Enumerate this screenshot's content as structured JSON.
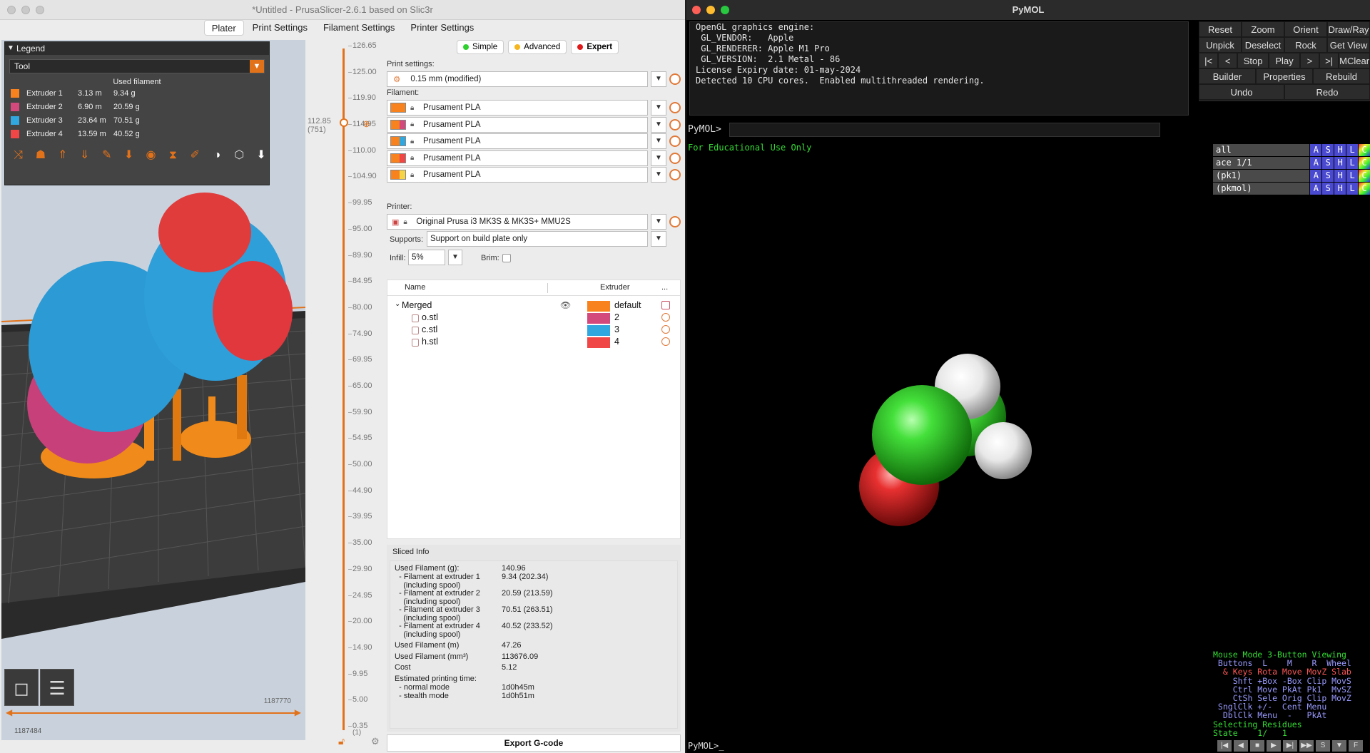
{
  "prusa": {
    "title": "*Untitled - PrusaSlicer-2.6.1 based on Slic3r",
    "tabs": [
      "Plater",
      "Print Settings",
      "Filament Settings",
      "Printer Settings"
    ],
    "legend": {
      "header": "Legend",
      "view_type": "Tool",
      "used_filament_label": "Used filament",
      "extruders": [
        {
          "name": "Extruder 1",
          "length": "3.13 m",
          "weight": "9.34 g",
          "color": "#f7821e"
        },
        {
          "name": "Extruder 2",
          "length": "6.90 m",
          "weight": "20.59 g",
          "color": "#d4497c"
        },
        {
          "name": "Extruder 3",
          "length": "23.64 m",
          "weight": "70.51 g",
          "color": "#31a7e0"
        },
        {
          "name": "Extruder 4",
          "length": "13.59 m",
          "weight": "40.52 g",
          "color": "#f04646"
        }
      ]
    },
    "hslider": {
      "right_value": "1187770",
      "left_value": "1187484"
    },
    "vslider": {
      "top_label": "112.85\n(751)",
      "ticks": [
        "126.65",
        "125.00",
        "119.90",
        "114.95",
        "110.00",
        "104.90",
        "99.95",
        "95.00",
        "89.90",
        "84.95",
        "80.00",
        "74.90",
        "69.95",
        "65.00",
        "59.90",
        "54.95",
        "50.00",
        "44.90",
        "39.95",
        "35.00",
        "29.90",
        "24.95",
        "20.00",
        "14.90",
        "9.95",
        "5.00",
        "0.35"
      ],
      "bottom_sub": "(1)"
    },
    "modes": [
      {
        "label": "Simple",
        "color": "#2fd02f"
      },
      {
        "label": "Advanced",
        "color": "#f5b61e"
      },
      {
        "label": "Expert",
        "color": "#e01a1a"
      }
    ],
    "print_settings_label": "Print settings:",
    "print_settings_value": "0.15 mm (modified)",
    "filament_label": "Filament:",
    "filaments": [
      {
        "name": "Prusament PLA",
        "c1": "#f7821e",
        "c2": "#f7821e"
      },
      {
        "name": "Prusament PLA",
        "c1": "#f7821e",
        "c2": "#d4497c"
      },
      {
        "name": "Prusament PLA",
        "c1": "#f7821e",
        "c2": "#31a7e0"
      },
      {
        "name": "Prusament PLA",
        "c1": "#f7821e",
        "c2": "#f04646"
      },
      {
        "name": "Prusament PLA",
        "c1": "#f7821e",
        "c2": "#f5d547"
      }
    ],
    "printer_label": "Printer:",
    "printer_value": "Original Prusa i3 MK3S & MK3S+ MMU2S",
    "supports_label": "Supports:",
    "supports_value": "Support on build plate only",
    "infill_label": "Infill:",
    "infill_value": "5%",
    "brim_label": "Brim:",
    "object_list": {
      "col_name": "Name",
      "col_extruder": "Extruder",
      "col_more": "...",
      "rows": [
        {
          "name": "Merged",
          "extruder": "default",
          "color": "#f7821e"
        },
        {
          "name": "o.stl",
          "extruder": "2",
          "color": "#d4497c"
        },
        {
          "name": "c.stl",
          "extruder": "3",
          "color": "#31a7e0"
        },
        {
          "name": "h.stl",
          "extruder": "4",
          "color": "#f04646"
        }
      ]
    },
    "sliced_info": {
      "title": "Sliced Info",
      "rows": [
        {
          "k": "Used Filament (g):",
          "v": "140.96"
        },
        {
          "k": "  - Filament at extruder 1",
          "v": "9.34 (202.34)"
        },
        {
          "k": "    (including spool)",
          "v": ""
        },
        {
          "k": "  - Filament at extruder 2",
          "v": "20.59 (213.59)"
        },
        {
          "k": "    (including spool)",
          "v": ""
        },
        {
          "k": "  - Filament at extruder 3",
          "v": "70.51 (263.51)"
        },
        {
          "k": "    (including spool)",
          "v": ""
        },
        {
          "k": "  - Filament at extruder 4",
          "v": "40.52 (233.52)"
        },
        {
          "k": "    (including spool)",
          "v": ""
        },
        {
          "k": "Used Filament (m)",
          "v": "47.26"
        },
        {
          "k": "Used Filament (mm³)",
          "v": "113676.09"
        },
        {
          "k": "Cost",
          "v": "5.12"
        },
        {
          "k": "Estimated printing time:",
          "v": ""
        },
        {
          "k": "  - normal mode",
          "v": "1d0h45m"
        },
        {
          "k": "  - stealth mode",
          "v": "1d0h51m"
        }
      ]
    },
    "export_label": "Export G-code"
  },
  "pymol": {
    "title": "PyMOL",
    "console_lines": [
      "OpenGL graphics engine:",
      " GL_VENDOR:   Apple",
      " GL_RENDERER: Apple M1 Pro",
      " GL_VERSION:  2.1 Metal - 86",
      "License Expiry date: 01-may-2024",
      "Detected 10 CPU cores.  Enabled multithreaded rendering."
    ],
    "prompt": "PyMOL>",
    "edu_note": "For Educational Use Only",
    "buttons": [
      [
        "Reset",
        "Zoom",
        "Orient",
        "Draw/Ray"
      ],
      [
        "Unpick",
        "Deselect",
        "Rock",
        "Get View"
      ],
      [
        "|<",
        "<",
        "Stop",
        "Play",
        ">",
        ">|",
        "MClear"
      ],
      [
        "Builder",
        "Properties",
        "Rebuild"
      ],
      [
        "Undo",
        "Redo"
      ]
    ],
    "objects": [
      "all",
      "ace 1/1",
      "(pk1)",
      "(pkmol)"
    ],
    "obj_buttons": [
      "A",
      "S",
      "H",
      "L",
      "C"
    ],
    "mouse_mode_lines": [
      "Mouse Mode 3-Button Viewing",
      " Buttons  L    M    R  Wheel",
      "  & Keys Rota Move MovZ Slab",
      "    Shft +Box -Box Clip MovS",
      "    Ctrl Move PkAt Pk1  MvSZ",
      "    CtSh Sele Orig Clip MovZ",
      " SnglClk +/-  Cent Menu",
      "  DblClk Menu  -   PkAt",
      "Selecting Residues",
      "State    1/   1"
    ],
    "bottom_prompt": "PyMOL>_"
  }
}
